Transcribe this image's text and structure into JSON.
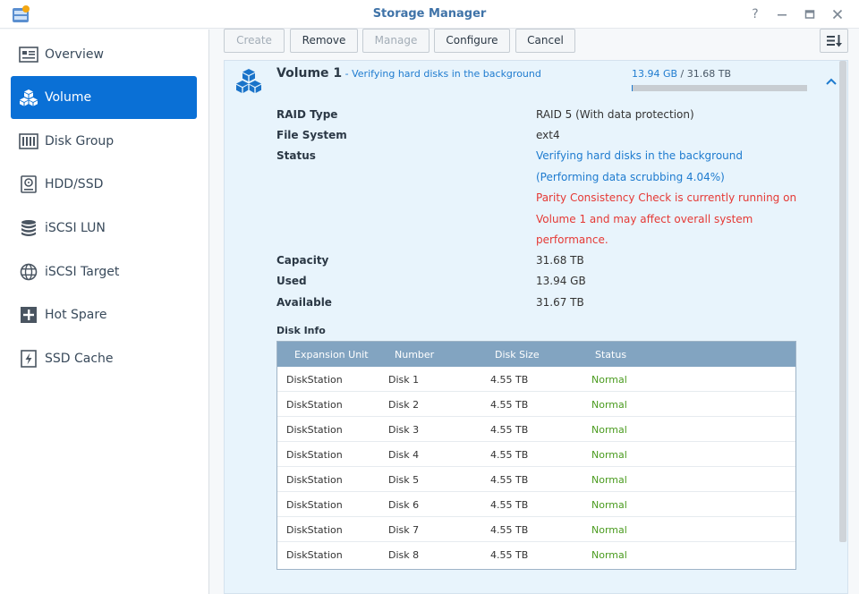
{
  "window": {
    "title": "Storage Manager",
    "help_glyph": "?",
    "minimize_glyph": "—",
    "restore_glyph": "▢",
    "close_glyph": "✕"
  },
  "sidebar": {
    "items": [
      {
        "label": "Overview",
        "icon": "overview-icon"
      },
      {
        "label": "Volume",
        "icon": "volume-icon",
        "active": true
      },
      {
        "label": "Disk Group",
        "icon": "disk-group-icon"
      },
      {
        "label": "HDD/SSD",
        "icon": "hdd-icon"
      },
      {
        "label": "iSCSI LUN",
        "icon": "lun-icon"
      },
      {
        "label": "iSCSI Target",
        "icon": "target-icon"
      },
      {
        "label": "Hot Spare",
        "icon": "hot-spare-icon"
      },
      {
        "label": "SSD Cache",
        "icon": "ssd-cache-icon"
      }
    ]
  },
  "toolbar": {
    "create": "Create",
    "remove": "Remove",
    "manage": "Manage",
    "configure": "Configure",
    "cancel": "Cancel"
  },
  "volume": {
    "name": "Volume 1",
    "subtitle": " - Verifying hard disks in the background",
    "used_text": "13.94 GB",
    "total_text": " / 31.68 TB",
    "usage_fraction": 0.0004,
    "properties": {
      "raid_label": "RAID Type",
      "raid_value": "RAID 5 (With data protection)",
      "fs_label": "File System",
      "fs_value": "ext4",
      "status_label": "Status",
      "status_line1": "Verifying hard disks in the background",
      "status_line2": "(Performing data scrubbing 4.04%)",
      "warning_line1": "Parity Consistency Check is currently running on",
      "warning_line2": "Volume 1 and may affect overall system",
      "warning_line3": "performance.",
      "capacity_label": "Capacity",
      "capacity_value": "31.68 TB",
      "used_label": "Used",
      "used_value": "13.94 GB",
      "available_label": "Available",
      "available_value": "31.67 TB"
    }
  },
  "disk_info": {
    "title": "Disk Info",
    "columns": [
      "Expansion Unit",
      "Number",
      "Disk Size",
      "Status"
    ],
    "rows": [
      [
        "DiskStation",
        "Disk 1",
        "4.55 TB",
        "Normal"
      ],
      [
        "DiskStation",
        "Disk 2",
        "4.55 TB",
        "Normal"
      ],
      [
        "DiskStation",
        "Disk 3",
        "4.55 TB",
        "Normal"
      ],
      [
        "DiskStation",
        "Disk 4",
        "4.55 TB",
        "Normal"
      ],
      [
        "DiskStation",
        "Disk 5",
        "4.55 TB",
        "Normal"
      ],
      [
        "DiskStation",
        "Disk 6",
        "4.55 TB",
        "Normal"
      ],
      [
        "DiskStation",
        "Disk 7",
        "4.55 TB",
        "Normal"
      ],
      [
        "DiskStation",
        "Disk 8",
        "4.55 TB",
        "Normal"
      ]
    ]
  },
  "colors": {
    "accent": "#0a70d6",
    "link": "#1e7bcf",
    "warning": "#e53935",
    "ok": "#4a9b1e"
  }
}
